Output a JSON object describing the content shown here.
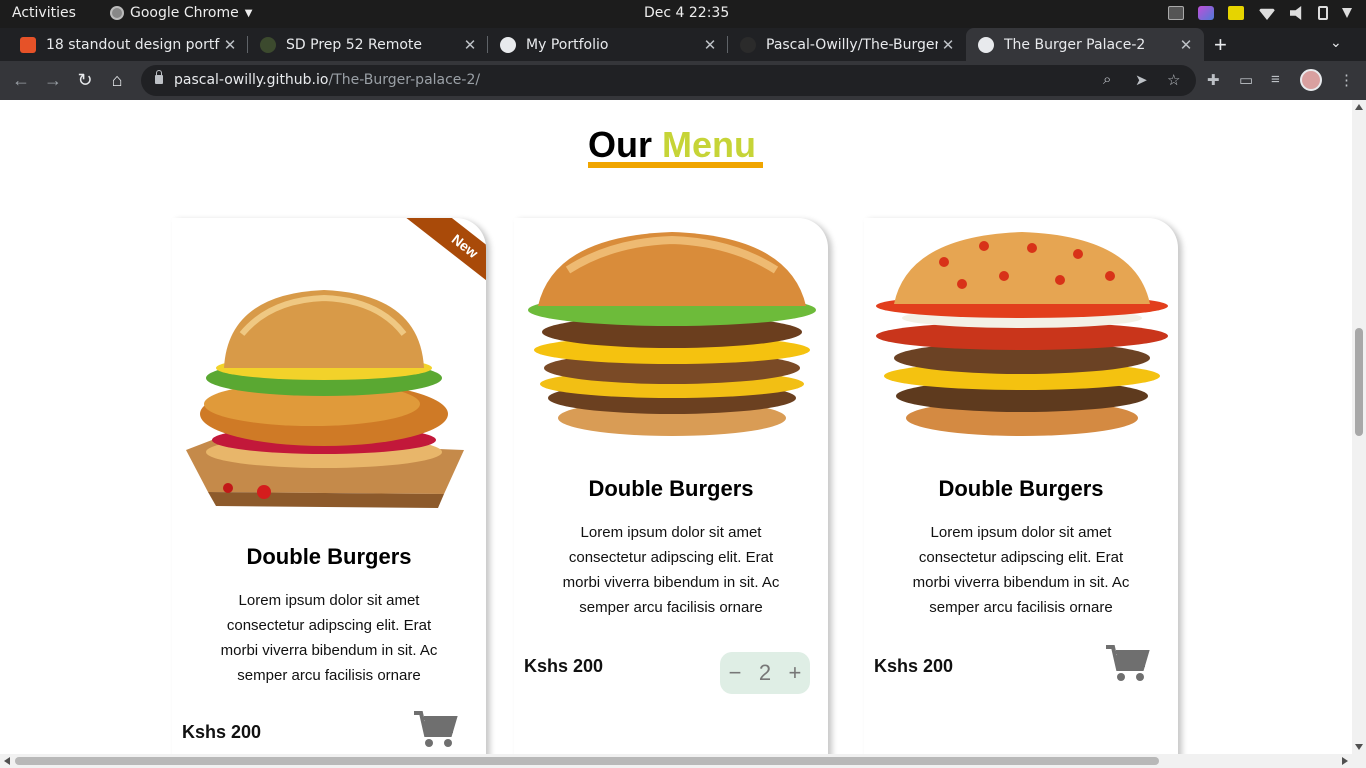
{
  "system": {
    "activities": "Activities",
    "app_name": "Google Chrome",
    "clock": "Dec 4  22:35"
  },
  "browser": {
    "tabs": [
      {
        "title": "18 standout design portfo",
        "favicon_color": "#e65228",
        "active": false
      },
      {
        "title": "SD Prep 52 Remote",
        "favicon_color": "#3c4a2e",
        "active": false
      },
      {
        "title": "My Portfolio",
        "favicon_color": "#e8eaed",
        "active": false
      },
      {
        "title": "Pascal-Owilly/The-Burger",
        "favicon_color": "#2b2b2b",
        "active": false
      },
      {
        "title": "The Burger Palace-2",
        "favicon_color": "#e8eaed",
        "active": true
      }
    ],
    "url_host": "pascal-owilly.github.io",
    "url_path": "/The-Burger-palace-2/"
  },
  "page": {
    "heading_main": "Our",
    "heading_accent": "Menu",
    "accent_color": "#c6d437",
    "underline_color": "#f0a500",
    "cards": [
      {
        "badge": "New",
        "title": "Double Burgers",
        "description": "Lorem ipsum dolor sit amet consectetur adipscing elit. Erat morbi viverra bibendum in sit. Ac semper arcu facilisis ornare",
        "price": "Kshs 200",
        "action": "cart-icon"
      },
      {
        "title": "Double Burgers",
        "description": "Lorem ipsum dolor sit amet consectetur adipscing elit. Erat morbi viverra bibendum in sit. Ac semper arcu facilisis ornare",
        "price": "Kshs 200",
        "action": "quantity-stepper",
        "quantity": "2",
        "minus": "−",
        "plus": "+"
      },
      {
        "title": "Double Burgers",
        "description": "Lorem ipsum dolor sit amet consectetur adipscing elit. Erat morbi viverra bibendum in sit. Ac semper arcu facilisis ornare",
        "price": "Kshs 200",
        "action": "cart-icon"
      }
    ]
  }
}
